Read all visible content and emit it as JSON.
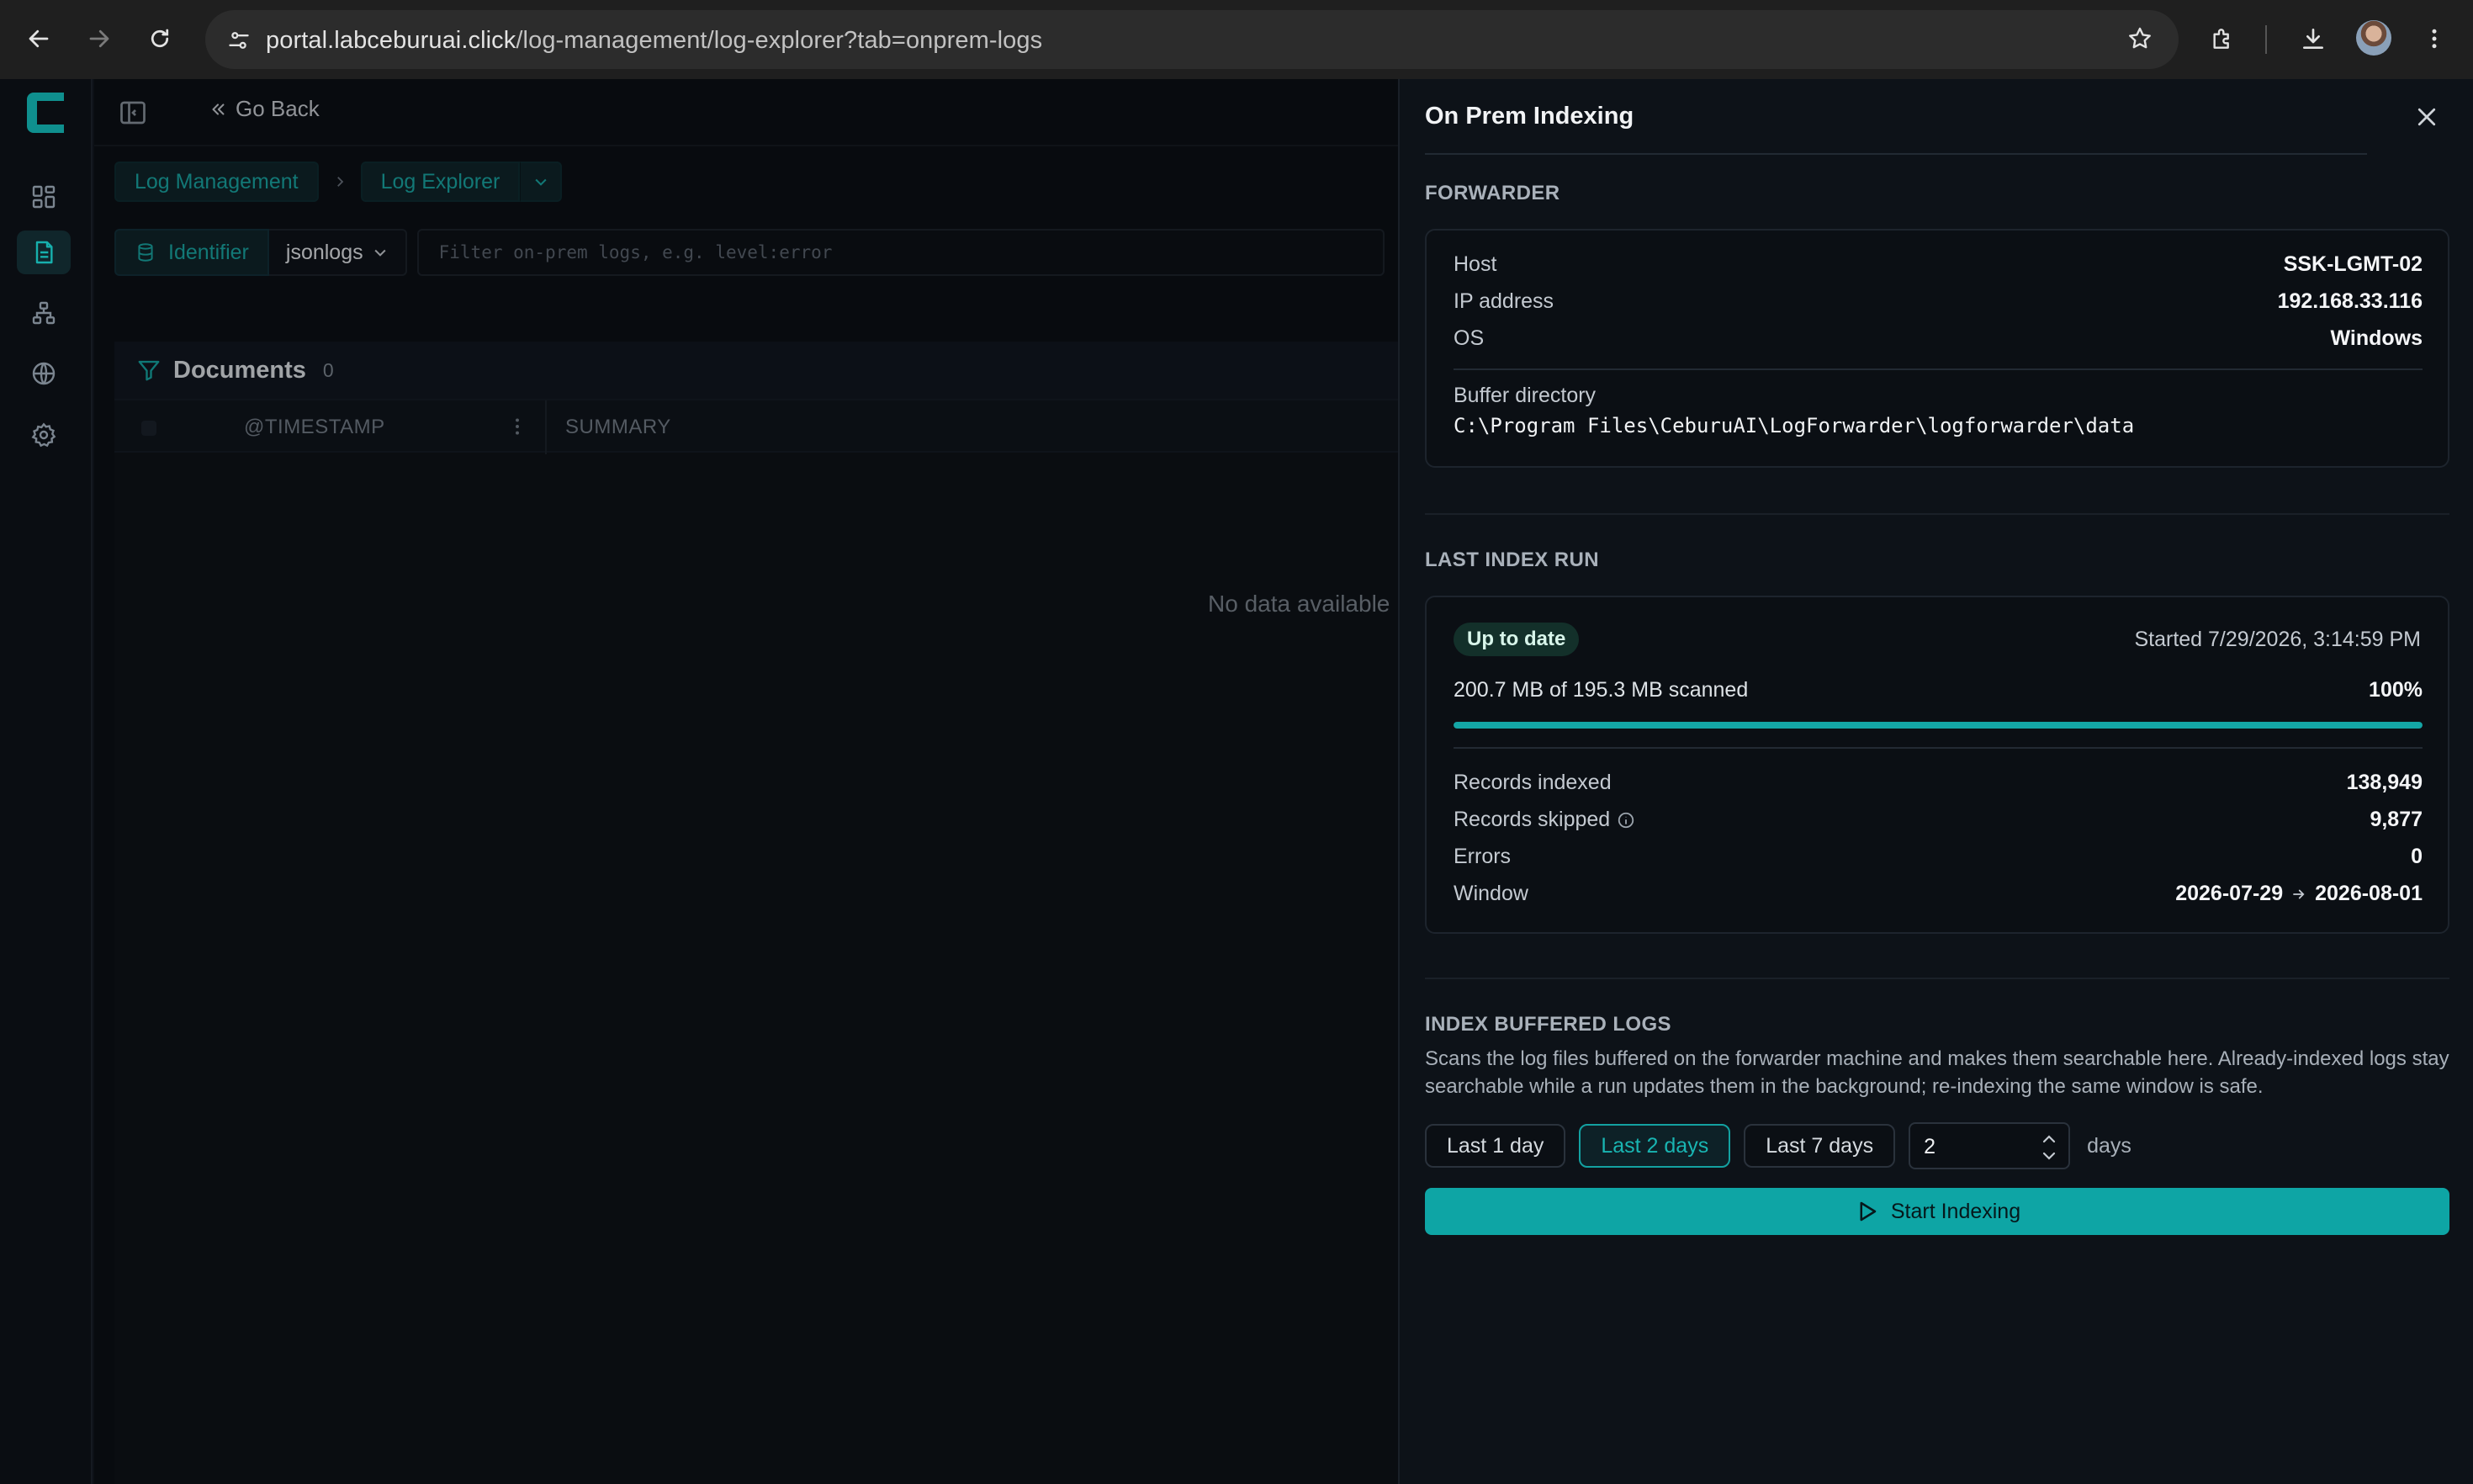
{
  "browser": {
    "url_host": "portal.labceburuai.click",
    "url_path": "/log-management/log-explorer?tab=onprem-logs"
  },
  "topbar": {
    "go_back": "Go Back"
  },
  "breadcrumb": {
    "level1": "Log Management",
    "level2": "Log Explorer"
  },
  "filter": {
    "identifier_label": "Identifier",
    "identifier_value": "jsonlogs",
    "placeholder": "Filter on-prem logs, e.g. level:error"
  },
  "documents": {
    "title": "Documents",
    "count": "0",
    "columns": [
      "@TIMESTAMP",
      "SUMMARY"
    ],
    "empty": "No data available"
  },
  "drawer": {
    "title": "On Prem Indexing",
    "forwarder": {
      "heading": "FORWARDER",
      "host_label": "Host",
      "host": "SSK-LGMT-02",
      "ip_label": "IP address",
      "ip": "192.168.33.116",
      "os_label": "OS",
      "os": "Windows",
      "buffer_label": "Buffer directory",
      "buffer_path": "C:\\Program Files\\CeburuAI\\LogForwarder\\logforwarder\\data"
    },
    "last_run": {
      "heading": "LAST INDEX RUN",
      "status": "Up to date",
      "started": "Started 7/29/2026, 3:14:59 PM",
      "scanned": "200.7 MB of 195.3 MB scanned",
      "percent": "100%",
      "progress": 1.0,
      "records_indexed_label": "Records indexed",
      "records_indexed": "138,949",
      "records_skipped_label": "Records skipped",
      "records_skipped": "9,877",
      "errors_label": "Errors",
      "errors": "0",
      "window_label": "Window",
      "window_from": "2026-07-29",
      "window_to": "2026-08-01"
    },
    "index_buffered": {
      "heading": "INDEX BUFFERED LOGS",
      "description": "Scans the log files buffered on the forwarder machine and makes them searchable here. Already-indexed logs stay searchable while a run updates them in the background; re-indexing the same window is safe.",
      "options": [
        "Last 1 day",
        "Last 2 days",
        "Last 7 days"
      ],
      "selected": "Last 2 days",
      "days_value": "2",
      "days_unit": "days",
      "start_button": "Start Indexing"
    }
  },
  "colors": {
    "accent": "#0ea5a5",
    "accent_text": "#1aa7a4",
    "badge_bg": "#13302a"
  }
}
